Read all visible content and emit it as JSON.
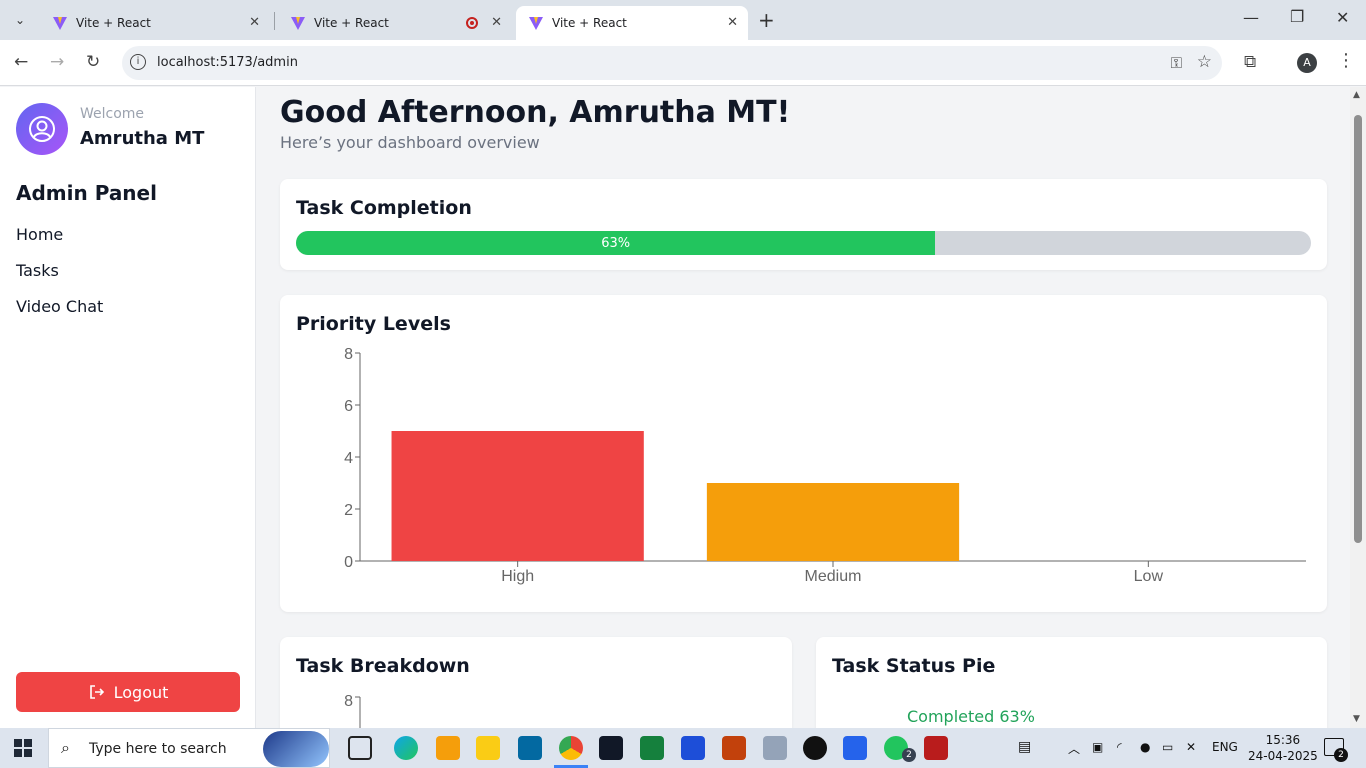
{
  "browser": {
    "tabs": [
      {
        "title": "Vite + React",
        "active": false
      },
      {
        "title": "Vite + React",
        "active": false,
        "recording": true
      },
      {
        "title": "Vite + React",
        "active": true
      }
    ],
    "url": "localhost:5173/admin",
    "profile_initial": "A"
  },
  "sidebar": {
    "welcome": "Welcome",
    "username": "Amrutha MT",
    "panel_title": "Admin Panel",
    "nav": [
      "Home",
      "Tasks",
      "Video Chat"
    ],
    "logout_label": "Logout"
  },
  "main": {
    "greeting": "Good Afternoon, Amrutha MT!",
    "subtitle": "Here’s your dashboard overview",
    "completion": {
      "title": "Task Completion",
      "percent": 63,
      "label": "63%"
    },
    "priority": {
      "title": "Priority Levels"
    },
    "breakdown": {
      "title": "Task Breakdown",
      "first_tick": "8"
    },
    "pie": {
      "title": "Task Status Pie",
      "legend_completed": "Completed 63%"
    }
  },
  "chart_data": {
    "type": "bar",
    "categories": [
      "High",
      "Medium",
      "Low"
    ],
    "values": [
      5,
      3,
      0
    ],
    "colors": [
      "#ef4444",
      "#f59e0b",
      "#22c55e"
    ],
    "title": "Priority Levels",
    "xlabel": "",
    "ylabel": "",
    "ylim": [
      0,
      8
    ],
    "yticks": [
      0,
      2,
      4,
      6,
      8
    ],
    "grid": false
  },
  "taskbar": {
    "search_placeholder": "Type here to search",
    "lang": "ENG",
    "time": "15:36",
    "date": "24-04-2025",
    "whatsapp_badge": "2",
    "notif_count": "2"
  }
}
